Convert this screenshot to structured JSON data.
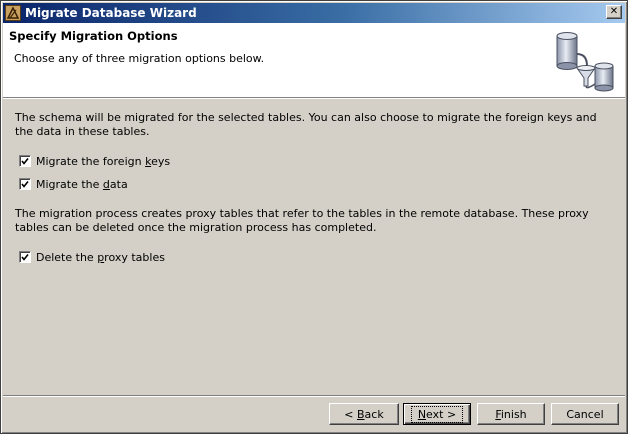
{
  "window": {
    "title": "Migrate Database Wizard",
    "close_glyph": "✕"
  },
  "header": {
    "title": "Specify Migration Options",
    "subtitle": "Choose any of three migration options below.",
    "graphic_icon": "database-funnel-icon"
  },
  "content": {
    "intro_text": "The schema will be migrated for the selected tables. You can also choose to migrate the foreign keys and the data in these tables.",
    "options": [
      {
        "label_before": "Migrate the foreign ",
        "mnemonic": "k",
        "label_after": "eys",
        "checked": true
      },
      {
        "label_before": "Migrate the ",
        "mnemonic": "d",
        "label_after": "ata",
        "checked": true
      }
    ],
    "proxy_text": "The migration process creates proxy tables that refer to the tables in the remote database. These proxy tables can be deleted once the migration process has completed.",
    "proxy_option": {
      "label_before": "Delete the ",
      "mnemonic": "p",
      "label_after": "roxy tables",
      "checked": true
    }
  },
  "buttons": {
    "back": {
      "prefix": "< ",
      "mnemonic": "B",
      "rest": "ack"
    },
    "next": {
      "prefix": "",
      "mnemonic": "N",
      "rest": "ext >"
    },
    "finish": {
      "prefix": "",
      "mnemonic": "F",
      "rest": "inish"
    },
    "cancel": {
      "prefix": "",
      "mnemonic": "",
      "rest": "Cancel"
    }
  },
  "colors": {
    "titlebar_start": "#0a246a",
    "titlebar_end": "#a6caf0",
    "dialog_face": "#d4d0c8",
    "header_bg": "#ffffff"
  }
}
